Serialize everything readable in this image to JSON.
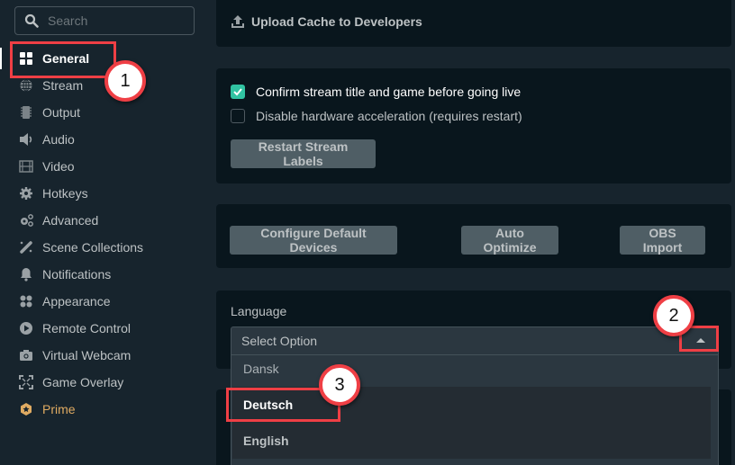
{
  "sidebar": {
    "search_placeholder": "Search",
    "items": [
      {
        "label": "General",
        "icon": "grid-icon",
        "active": true
      },
      {
        "label": "Stream",
        "icon": "globe-icon"
      },
      {
        "label": "Output",
        "icon": "chip-icon"
      },
      {
        "label": "Audio",
        "icon": "speaker-icon"
      },
      {
        "label": "Video",
        "icon": "film-icon"
      },
      {
        "label": "Hotkeys",
        "icon": "gear-icon"
      },
      {
        "label": "Advanced",
        "icon": "gears-icon"
      },
      {
        "label": "Scene Collections",
        "icon": "magic-wand-icon"
      },
      {
        "label": "Notifications",
        "icon": "bell-icon"
      },
      {
        "label": "Appearance",
        "icon": "palette-icon"
      },
      {
        "label": "Remote Control",
        "icon": "play-circle-icon"
      },
      {
        "label": "Virtual Webcam",
        "icon": "camera-icon"
      },
      {
        "label": "Game Overlay",
        "icon": "expand-icon"
      },
      {
        "label": "Prime",
        "icon": "prime-badge-icon"
      }
    ]
  },
  "main": {
    "upload_label": "Upload Cache to Developers",
    "checkboxes": [
      {
        "label": "Confirm stream title and game before going live",
        "checked": true
      },
      {
        "label": "Disable hardware acceleration (requires restart)",
        "checked": false
      }
    ],
    "restart_label": "Restart Stream Labels",
    "buttons": {
      "configure": "Configure Default Devices",
      "auto_optimize": "Auto Optimize",
      "obs_import": "OBS Import"
    },
    "language": {
      "label": "Language",
      "placeholder": "Select Option",
      "options": [
        "Dansk",
        "Deutsch",
        "English"
      ]
    }
  },
  "annotations": {
    "step1": "1",
    "step2": "2",
    "step3": "3"
  },
  "colors": {
    "accent_check": "#31c3a2",
    "prime": "#e0ab62",
    "annotation": "#ef3f45"
  }
}
